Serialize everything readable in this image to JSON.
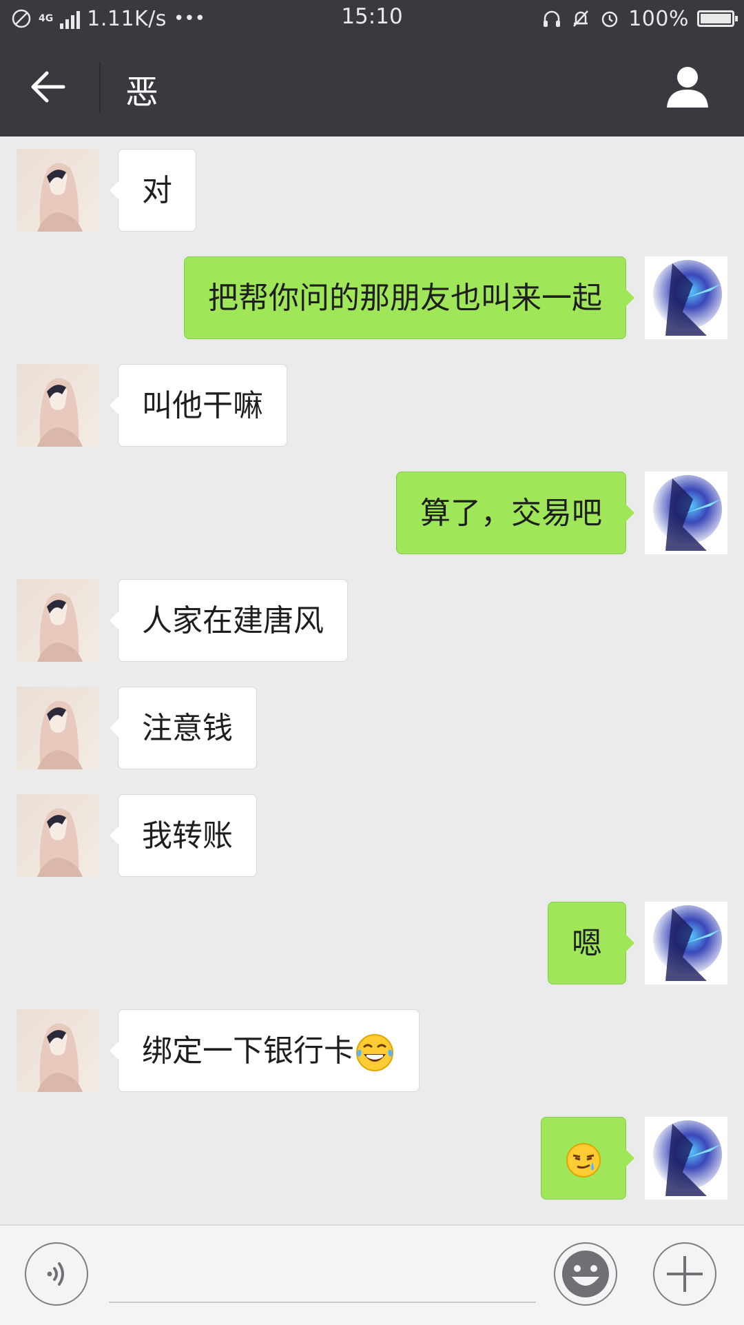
{
  "status_bar": {
    "network": "4G",
    "speed": "1.11K/s",
    "more": "•••",
    "time": "15:10",
    "battery": "100%"
  },
  "header": {
    "title": "恶"
  },
  "messages": [
    {
      "side": "in",
      "text": "对"
    },
    {
      "side": "out",
      "text": "把帮你问的那朋友也叫来一起"
    },
    {
      "side": "in",
      "text": "叫他干嘛"
    },
    {
      "side": "out",
      "text": "算了，交易吧"
    },
    {
      "side": "in",
      "text": "人家在建唐风"
    },
    {
      "side": "in",
      "text": "注意钱"
    },
    {
      "side": "in",
      "text": "我转账"
    },
    {
      "side": "out",
      "text": "嗯"
    },
    {
      "side": "in",
      "text": "绑定一下银行卡",
      "emoji": "tears-of-joy-emoji"
    },
    {
      "side": "out",
      "text": "",
      "emoji": "smirk-sweat-emoji"
    }
  ],
  "icons": {
    "back": "back-arrow-icon",
    "profile": "person-icon",
    "voice": "voice-icon",
    "emoji": "smiley-icon",
    "plus": "plus-icon"
  },
  "colors": {
    "header_bg": "#393a3f",
    "chat_bg": "#ebebeb",
    "outgoing_bubble": "#9fe658",
    "incoming_bubble": "#ffffff"
  }
}
